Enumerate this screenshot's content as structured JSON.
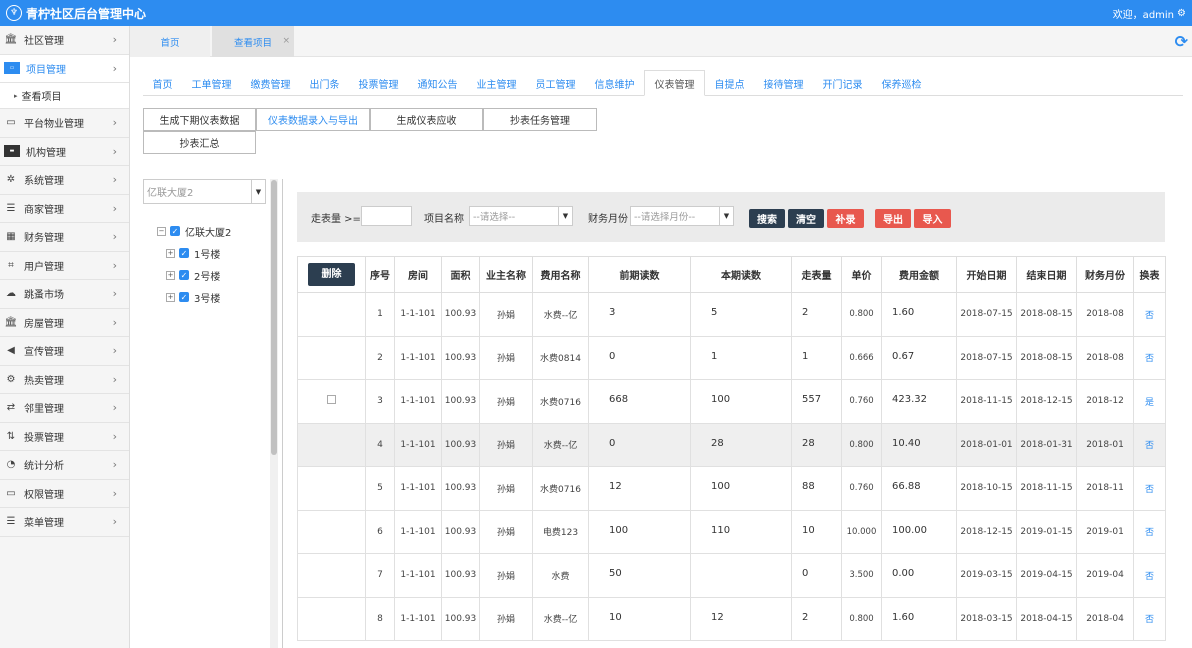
{
  "header": {
    "title": "青柠社区后台管理中心",
    "welcome": "欢迎，admin"
  },
  "sidebar": {
    "items": [
      {
        "label": "社区管理",
        "icon": "bank-icon"
      },
      {
        "label": "项目管理",
        "icon": "sitemap-icon"
      },
      {
        "label": "平台物业管理",
        "icon": "monitor-icon"
      },
      {
        "label": "机构管理",
        "icon": "stripe-icon"
      },
      {
        "label": "系统管理",
        "icon": "yelp-icon"
      },
      {
        "label": "商家管理",
        "icon": "bars-icon"
      },
      {
        "label": "财务管理",
        "icon": "calculator-icon"
      },
      {
        "label": "用户管理",
        "icon": "crop-icon"
      },
      {
        "label": "跳蚤市场",
        "icon": "cloud-icon"
      },
      {
        "label": "房屋管理",
        "icon": "bank-icon"
      },
      {
        "label": "宣传管理",
        "icon": "volume-icon"
      },
      {
        "label": "热卖管理",
        "icon": "gear-icon"
      },
      {
        "label": "邻里管理",
        "icon": "retweet-icon"
      },
      {
        "label": "投票管理",
        "icon": "sort-icon"
      },
      {
        "label": "统计分析",
        "icon": "pie-chart-icon"
      },
      {
        "label": "权限管理",
        "icon": "desktop-icon"
      },
      {
        "label": "菜单管理",
        "icon": "list-icon"
      }
    ],
    "sub_item": "查看项目"
  },
  "page_tabs": {
    "home": "首页",
    "current": "查看项目"
  },
  "nav_tabs": [
    "首页",
    "工单管理",
    "缴费管理",
    "出门条",
    "投票管理",
    "通知公告",
    "业主管理",
    "员工管理",
    "信息维护",
    "仪表管理",
    "自提点",
    "接待管理",
    "开门记录",
    "保养巡检"
  ],
  "sub_buttons": [
    "生成下期仪表数据",
    "仪表数据录入与导出",
    "生成仪表应收",
    "抄表任务管理",
    "抄表汇总"
  ],
  "tree": {
    "select_value": "亿联大厦2",
    "root": "亿联大厦2",
    "children": [
      "1号楼",
      "2号楼",
      "3号楼"
    ]
  },
  "filter": {
    "walk_label": "走表量 >=",
    "project_label": "项目名称",
    "project_placeholder": "--请选择--",
    "month_label": "财务月份",
    "month_placeholder": "--请选择月份--",
    "search": "搜索",
    "clear": "清空",
    "supplement": "补录",
    "export": "导出",
    "import": "导入"
  },
  "table": {
    "delete_label": "删除",
    "columns": [
      "序号",
      "房间",
      "面积",
      "业主名称",
      "费用名称",
      "前期读数",
      "本期读数",
      "走表量",
      "单价",
      "费用金额",
      "开始日期",
      "结束日期",
      "财务月份",
      "换表"
    ],
    "rows": [
      [
        "1",
        "1-1-101",
        "100.93",
        "孙娟",
        "水费--亿",
        "3",
        "5",
        "2",
        "0.800",
        "1.60",
        "2018-07-15",
        "2018-08-15",
        "2018-08",
        "否"
      ],
      [
        "2",
        "1-1-101",
        "100.93",
        "孙娟",
        "水费0814",
        "0",
        "1",
        "1",
        "0.666",
        "0.67",
        "2018-07-15",
        "2018-08-15",
        "2018-08",
        "否"
      ],
      [
        "3",
        "1-1-101",
        "100.93",
        "孙娟",
        "水费0716",
        "668",
        "100",
        "557",
        "0.760",
        "423.32",
        "2018-11-15",
        "2018-12-15",
        "2018-12",
        "是"
      ],
      [
        "4",
        "1-1-101",
        "100.93",
        "孙娟",
        "水费--亿",
        "0",
        "28",
        "28",
        "0.800",
        "10.40",
        "2018-01-01",
        "2018-01-31",
        "2018-01",
        "否"
      ],
      [
        "5",
        "1-1-101",
        "100.93",
        "孙娟",
        "水费0716",
        "12",
        "100",
        "88",
        "0.760",
        "66.88",
        "2018-10-15",
        "2018-11-15",
        "2018-11",
        "否"
      ],
      [
        "6",
        "1-1-101",
        "100.93",
        "孙娟",
        "电费123",
        "100",
        "110",
        "10",
        "10.000",
        "100.00",
        "2018-12-15",
        "2019-01-15",
        "2019-01",
        "否"
      ],
      [
        "7",
        "1-1-101",
        "100.93",
        "孙娟",
        "水费",
        "50",
        "",
        "0",
        "3.500",
        "0.00",
        "2019-03-15",
        "2019-04-15",
        "2019-04",
        "否"
      ],
      [
        "8",
        "1-1-101",
        "100.93",
        "孙娟",
        "水费--亿",
        "10",
        "12",
        "2",
        "0.800",
        "1.60",
        "2018-03-15",
        "2018-04-15",
        "2018-04",
        "否"
      ]
    ]
  }
}
